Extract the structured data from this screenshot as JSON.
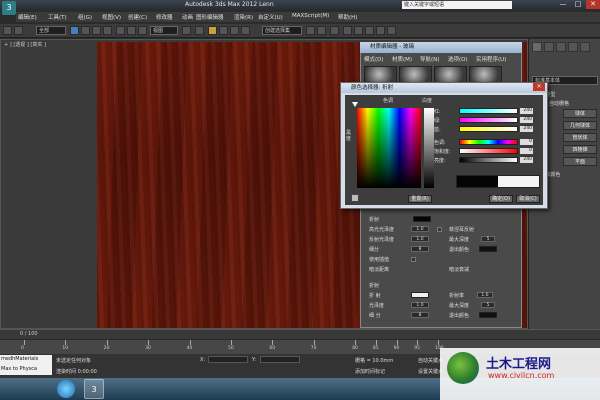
{
  "window": {
    "title": "Autodesk 3ds Max  2012     Lenn",
    "help_search_placeholder": "键入关键字或短语",
    "controls": [
      "—",
      "□",
      "✕"
    ]
  },
  "menubar": {
    "items": [
      "编辑(E)",
      "工具(T)",
      "组(G)",
      "视图(V)",
      "创建(C)",
      "修改器",
      "动画",
      "图形编辑器",
      "渲染(R)",
      "自定义(U)",
      "MAXScript(M)",
      "帮助(H)"
    ]
  },
  "toolbar": {
    "selection_filter": "全部",
    "ref_coord": "视图",
    "named_sel": "创建选择集"
  },
  "viewport": {
    "label": "+ ] [透视 ] [真实 ]"
  },
  "command_panel": {
    "dropdown": "标准基本体",
    "rollout_object_type": "- 对象类型",
    "auto_grid": "自动栅格",
    "primitives": [
      "长方体",
      "圆锥体",
      "球体",
      "几何球体",
      "圆柱体",
      "管状体",
      "圆环",
      "四棱锥",
      "茶壶",
      "平面"
    ],
    "rollout_name_color": "- 名称和颜色"
  },
  "material_editor": {
    "title": "材质编辑器 - 玻璃",
    "menus": [
      "模式(D)",
      "材质(M)",
      "导航(N)",
      "选项(O)",
      "实用程序(U)"
    ],
    "section_refraction": "折射",
    "params": {
      "refl_gloss_label": "高光光泽度",
      "refl_gloss_value": "1.0",
      "refr_gloss_label": "反射光泽度",
      "refr_gloss_value": "1.0",
      "subdivs_label": "细分",
      "subdivs_value": "8",
      "use_interp_label": "使用插值",
      "dim_dist_label": "暗淡距离",
      "fresnel_label": "菲涅耳反射",
      "max_depth_label": "最大深度",
      "max_depth_value": "5",
      "exit_color_label": "退出颜色",
      "dim_falloff_label": "暗淡衰减",
      "refraction_label": "折射",
      "refr_label": "折 射",
      "ior_label": "折射率",
      "ior_value": "1.6",
      "gloss_label": "光泽度",
      "gloss_value": "1.0",
      "max_depth2_label": "最大深度",
      "max_depth2_value": "5",
      "subdivs2_label": "细 分",
      "subdivs2_value": "8",
      "exit_color2_label": "退出颜色"
    }
  },
  "color_picker": {
    "title": "颜色选择器: 折射",
    "hue_label": "色调",
    "white_label": "白度",
    "black_label": "黑度",
    "rows": [
      {
        "label": "红:",
        "value": "240"
      },
      {
        "label": "绿:",
        "value": "240"
      },
      {
        "label": "蓝:",
        "value": "240"
      },
      {
        "label": "色调:",
        "value": "0"
      },
      {
        "label": "饱和度:",
        "value": "0"
      },
      {
        "label": "亮度:",
        "value": "240"
      }
    ],
    "reset_label": "重置(R)",
    "ok_label": "确定(O)",
    "cancel_label": "取消(C)"
  },
  "timeline": {
    "frame_range": "0 / 100",
    "ticks": [
      "0",
      "10",
      "20",
      "30",
      "40",
      "50",
      "60",
      "70",
      "80",
      "85",
      "90",
      "95",
      "100"
    ]
  },
  "status": {
    "maxscript_line1": "medhMaterials",
    "maxscript_line2": "Max to Physca",
    "selection": "未选定任何对象",
    "render_time": "渲染时间 0:00:00",
    "grid": "栅格 = 10.0mm",
    "auto_key": "自动关键点",
    "set_key": "设置关键点",
    "add_time_tag": "添加时间标记",
    "x_label": "X:",
    "y_label": "Y:"
  },
  "watermark": {
    "title": "土木工程网",
    "url": "www.civilcn.com"
  },
  "colors": {
    "wood": "#6e1a0c",
    "titlebar": "#262b33",
    "panel": "#444444",
    "taskbar": "#1f3b52"
  }
}
